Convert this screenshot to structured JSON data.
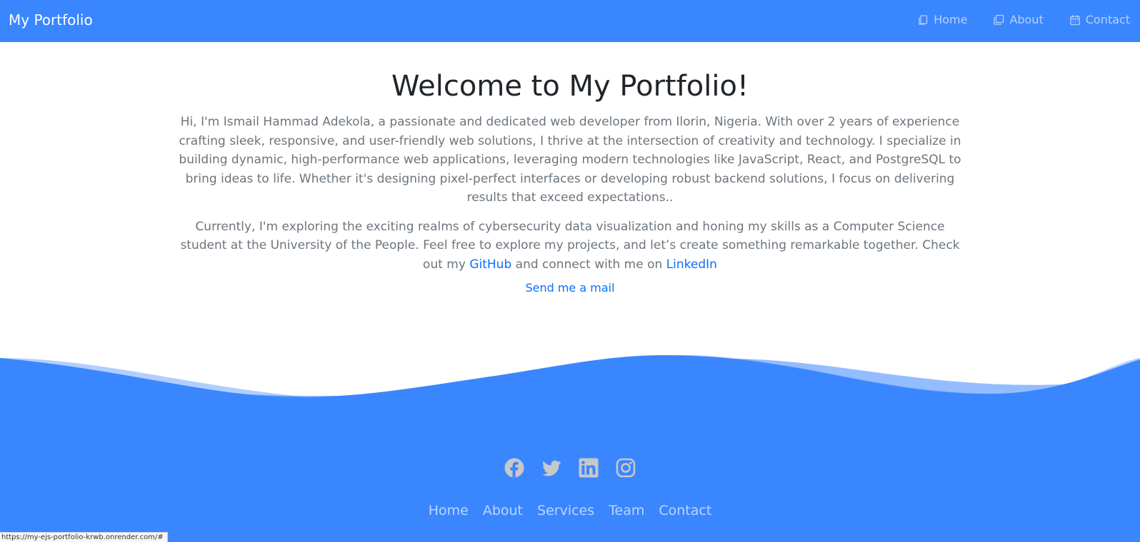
{
  "navbar": {
    "brand": "My Portfolio",
    "links": [
      {
        "label": "Home",
        "icon": "copy-icon"
      },
      {
        "label": "About",
        "icon": "stack-icon"
      },
      {
        "label": "Contact",
        "icon": "calendar-icon"
      }
    ]
  },
  "hero": {
    "title": "Welcome to My Portfolio!",
    "paragraph1": "Hi, I'm Ismail Hammad Adekola, a passionate and dedicated web developer from Ilorin, Nigeria. With over 2 years of experience crafting sleek, responsive, and user-friendly web solutions, I thrive at the intersection of creativity and technology. I specialize in building dynamic, high-performance web applications, leveraging modern technologies like JavaScript, React, and PostgreSQL to bring ideas to life. Whether it's designing pixel-perfect interfaces or developing robust backend solutions, I focus on delivering results that exceed expectations..",
    "paragraph2_before": "Currently, I'm exploring the exciting realms of cybersecurity data visualization and honing my skills as a Computer Science student at the University of the People. Feel free to explore my projects, and let’s create something remarkable together. Check out my ",
    "github_label": "GitHub",
    "paragraph2_middle": " and connect with me on ",
    "linkedin_label": "LinkedIn",
    "mail_label": "Send me a mail"
  },
  "footer": {
    "socials": [
      "facebook-icon",
      "twitter-icon",
      "linkedin-icon",
      "instagram-icon"
    ],
    "links": [
      "Home",
      "About",
      "Services",
      "Team",
      "Contact"
    ]
  },
  "status_url": "https://my-ejs-portfolio-krwb.onrender.com/#",
  "colors": {
    "primary": "#3a86ff",
    "link": "#0d6efd",
    "text_muted": "#6c757d",
    "icon_gray": "#c8c8c8"
  }
}
